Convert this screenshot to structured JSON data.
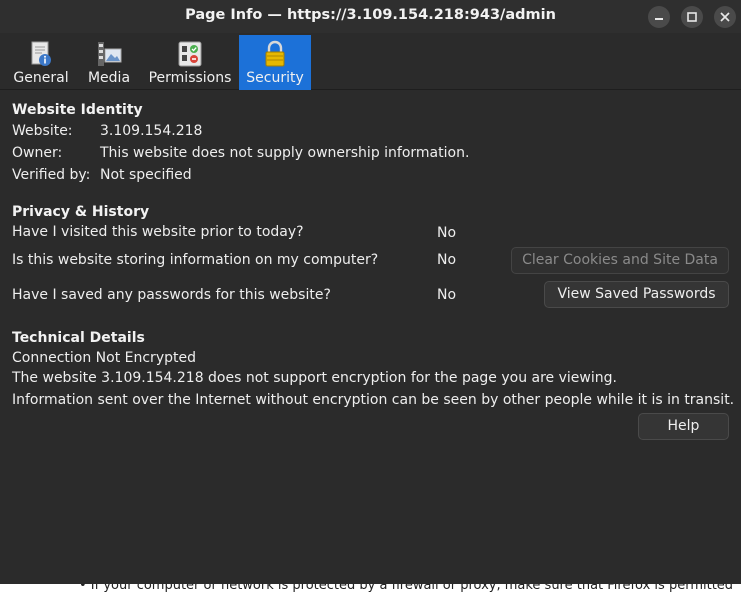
{
  "window": {
    "title": "Page Info — https://3.109.154.218:943/admin"
  },
  "tabs": [
    {
      "label": "General",
      "icon": "info-document-icon",
      "active": false
    },
    {
      "label": "Media",
      "icon": "media-icon",
      "active": false
    },
    {
      "label": "Permissions",
      "icon": "permissions-icon",
      "active": false
    },
    {
      "label": "Security",
      "icon": "padlock-icon",
      "active": true
    }
  ],
  "identity": {
    "heading": "Website Identity",
    "website_label": "Website:",
    "website_value": "3.109.154.218",
    "owner_label": "Owner:",
    "owner_value": "This website does not supply ownership information.",
    "verified_label": "Verified by:",
    "verified_value": "Not specified"
  },
  "privacy": {
    "heading": "Privacy & History",
    "q1": "Have I visited this website prior to today?",
    "a1": "No",
    "q2": "Is this website storing information on my computer?",
    "a2": "No",
    "clear_button": "Clear Cookies and Site Data",
    "q3": "Have I saved any passwords for this website?",
    "a3": "No",
    "passwords_button": "View Saved Passwords"
  },
  "technical": {
    "heading": "Technical Details",
    "line1": "Connection Not Encrypted",
    "line2": "The website 3.109.154.218 does not support encryption for the page you are viewing.",
    "line3": "Information sent over the Internet without encryption can be seen by other people while it is in transit.",
    "help_button": "Help"
  },
  "background_text": "If your computer or network is protected by a firewall or proxy, make sure that Firefox is permitted",
  "colors": {
    "accent": "#1c71d8",
    "background": "#2b2b2b"
  }
}
